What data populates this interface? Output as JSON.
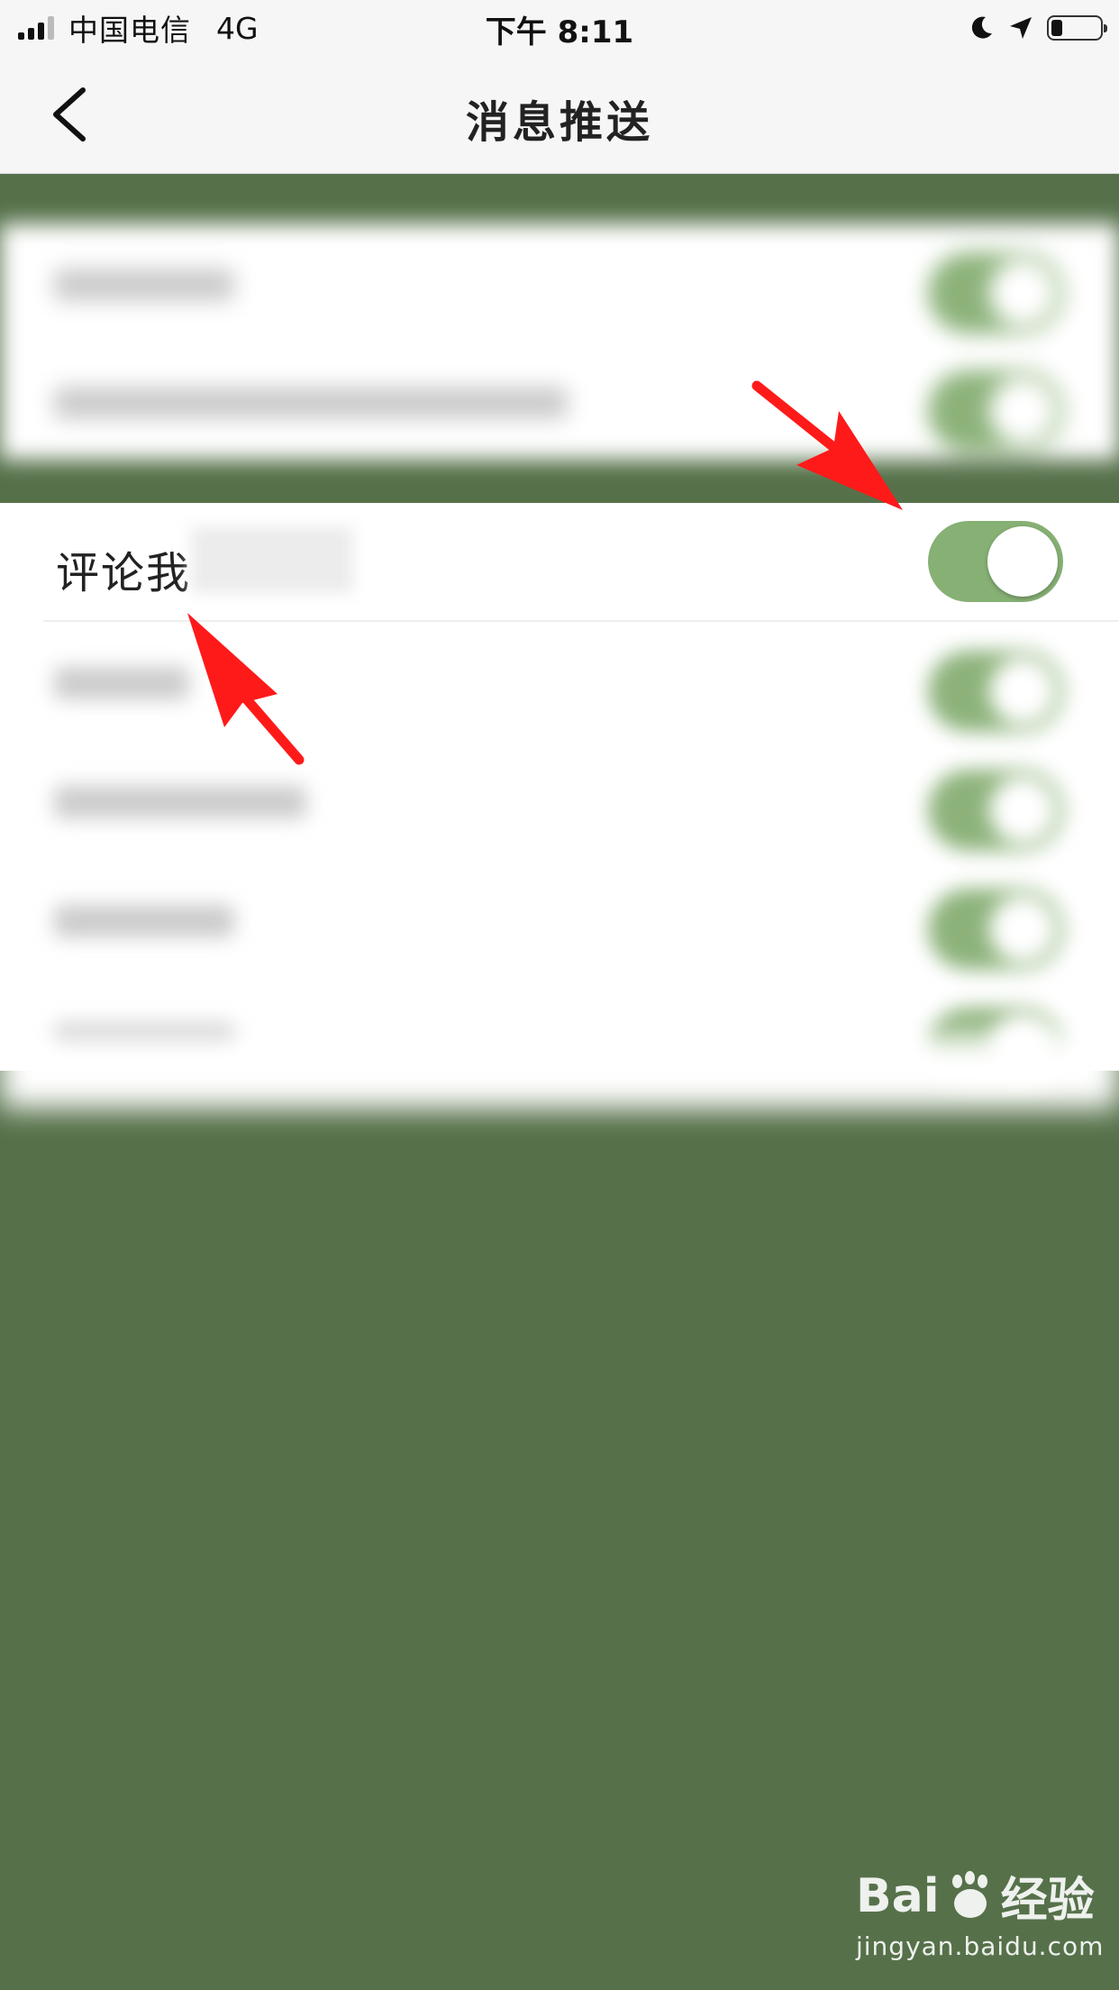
{
  "status_bar": {
    "carrier": "中国电信",
    "network": "4G",
    "time": "下午 8:11"
  },
  "nav": {
    "title": "消息推送",
    "back_icon": "chevron-left-icon"
  },
  "list": {
    "highlighted_row": {
      "label": "评论我",
      "toggle_on": true
    }
  },
  "colors": {
    "toggle_on": "#86b074",
    "overlay": "#56714a",
    "arrow": "#ff1a1a"
  },
  "watermark": {
    "logo_left": "Bai",
    "logo_right": "经验",
    "url": "jingyan.baidu.com"
  }
}
